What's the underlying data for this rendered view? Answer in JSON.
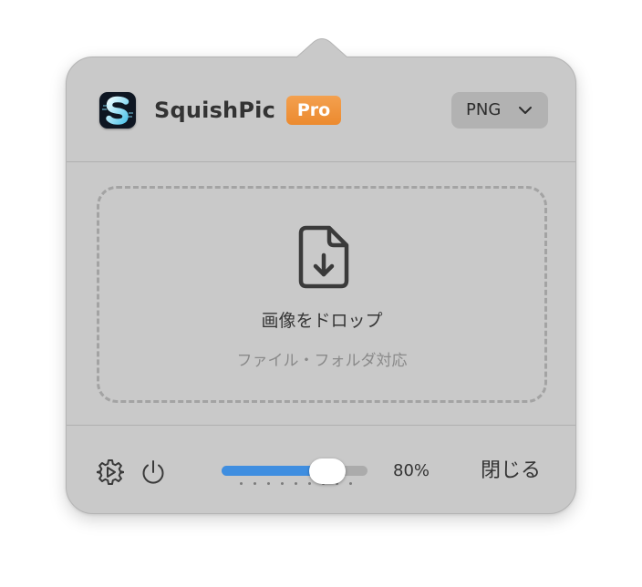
{
  "app": {
    "name": "SquishPic",
    "badge": "Pro",
    "icon": "squishpic-app-icon"
  },
  "format_select": {
    "value": "PNG",
    "icon": "chevron-down-icon"
  },
  "drop_zone": {
    "title": "画像をドロップ",
    "subtitle": "ファイル・フォルダ対応",
    "icon": "file-download-icon"
  },
  "footer": {
    "settings_icon": "gear-icon",
    "power_icon": "power-icon",
    "quality": {
      "value": 0.8,
      "label": "80%",
      "tick_count": 9
    },
    "close_label": "閉じる"
  },
  "colors": {
    "popover_bg": "#c9c9c9",
    "accent": "#3f8ee0",
    "pro_badge": "#ec8a2f",
    "app_icon_bg": "#0e1622"
  }
}
